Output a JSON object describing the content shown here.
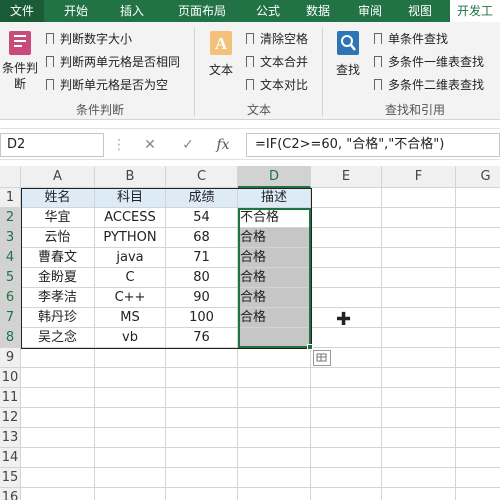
{
  "tabs": [
    "文件",
    "开始",
    "插入",
    "页面布局",
    "公式",
    "数据",
    "审阅",
    "视图",
    "开发工"
  ],
  "ribbon": {
    "group1": {
      "big_label": "条件判断",
      "items": [
        "判断数字大小",
        "判断两单元格是否相同",
        "判断单元格是否为空"
      ],
      "label": "条件判断"
    },
    "group2": {
      "big_label": "文本",
      "items": [
        "清除空格",
        "文本合并",
        "文本对比"
      ],
      "label": "文本"
    },
    "group3": {
      "big_label": "查找",
      "items": [
        "单条件查找",
        "多条件一维表查找",
        "多条件二维表查找"
      ],
      "label": "查找和引用"
    }
  },
  "formula_bar": {
    "name_box": "D2",
    "cancel": "✕",
    "enter": "✓",
    "fx": "fx",
    "formula": "=IF(C2>=60, \"合格\",\"不合格\")"
  },
  "columns": [
    "A",
    "B",
    "C",
    "D",
    "E",
    "F",
    "G"
  ],
  "rows": [
    "1",
    "2",
    "3",
    "4",
    "5",
    "6",
    "7",
    "8",
    "9",
    "10",
    "11",
    "12",
    "13",
    "14",
    "15",
    "16"
  ],
  "table": {
    "headers": [
      "姓名",
      "科目",
      "成绩",
      "描述"
    ],
    "data": [
      [
        "华宜",
        "ACCESS",
        "54",
        "不合格"
      ],
      [
        "云怡",
        "PYTHON",
        "68",
        "合格"
      ],
      [
        "曹春文",
        "java",
        "71",
        "合格"
      ],
      [
        "金盼夏",
        "C",
        "80",
        "合格"
      ],
      [
        "李孝洁",
        "C++",
        "90",
        "合格"
      ],
      [
        "韩丹珍",
        "MS",
        "100",
        "合格"
      ],
      [
        "吴之念",
        "vb",
        "76",
        ""
      ]
    ]
  },
  "colors": {
    "accent": "#217346",
    "header_fill": "#ddebf7",
    "shaded_fill": "#c6c6c6"
  }
}
